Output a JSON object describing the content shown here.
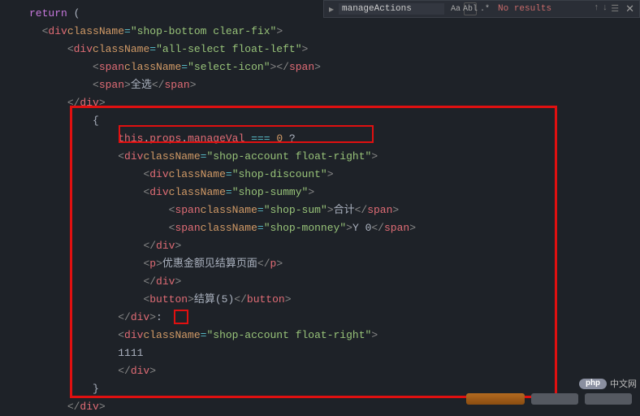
{
  "find": {
    "value": "manageActions",
    "results": "No results",
    "case_icon": "Aa",
    "word_icon": "Abl",
    "regex_icon": ".*"
  },
  "code": {
    "return_kw": "return",
    "open_paren": " (",
    "l1": {
      "cls": "shop-bottom clear-fix"
    },
    "l2": {
      "cls": "all-select float-left"
    },
    "l3": {
      "cls": "select-icon"
    },
    "l4_text": "全选",
    "l6_condition": {
      "this": "this",
      "dot1": ".",
      "props": "props",
      "dot2": ".",
      "manageVal": "manageVal",
      "op": " === ",
      "zero": "0",
      "q": " ?"
    },
    "l7": {
      "cls": "shop-account float-right"
    },
    "l8": {
      "cls": "shop-discount"
    },
    "l9": {
      "cls": "shop-summy"
    },
    "l10": {
      "cls": "shop-sum",
      "text": "合计"
    },
    "l11": {
      "cls": "shop-monney",
      "text": "Y 0"
    },
    "l13_text": "优惠金额见结算页面",
    "l15_text": "结算(5)",
    "l16_colon": ":",
    "l17": {
      "cls": "shop-account float-right"
    },
    "l18_text": "1111"
  },
  "watermark": {
    "badge": "php",
    "text": "中文网"
  }
}
